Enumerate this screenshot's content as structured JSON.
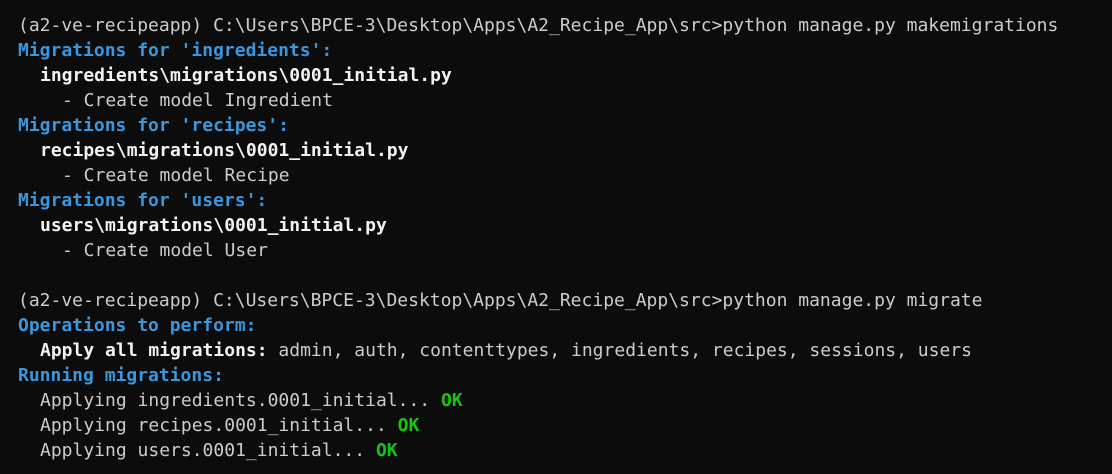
{
  "terminal": {
    "prompt1": "(a2-ve-recipeapp) C:\\Users\\BPCE-3\\Desktop\\Apps\\A2_Recipe_App\\src>python manage.py makemigrations",
    "mig_ingredients_header": "Migrations for 'ingredients':",
    "mig_ingredients_file": "ingredients\\migrations\\0001_initial.py",
    "mig_ingredients_action": "- Create model Ingredient",
    "mig_recipes_header": "Migrations for 'recipes':",
    "mig_recipes_file": "recipes\\migrations\\0001_initial.py",
    "mig_recipes_action": "- Create model Recipe",
    "mig_users_header": "Migrations for 'users':",
    "mig_users_file": "users\\migrations\\0001_initial.py",
    "mig_users_action": "- Create model User",
    "prompt2": "(a2-ve-recipeapp) C:\\Users\\BPCE-3\\Desktop\\Apps\\A2_Recipe_App\\src>python manage.py migrate",
    "ops_header": "Operations to perform:",
    "apply_label": "Apply all migrations:",
    "apply_apps": " admin, auth, contenttypes, ingredients, recipes, sessions, users",
    "running_header": "Running migrations:",
    "applying": [
      {
        "text": "Applying ingredients.0001_initial...",
        "status": "OK"
      },
      {
        "text": "Applying recipes.0001_initial...",
        "status": "OK"
      },
      {
        "text": "Applying users.0001_initial...",
        "status": "OK"
      }
    ]
  }
}
